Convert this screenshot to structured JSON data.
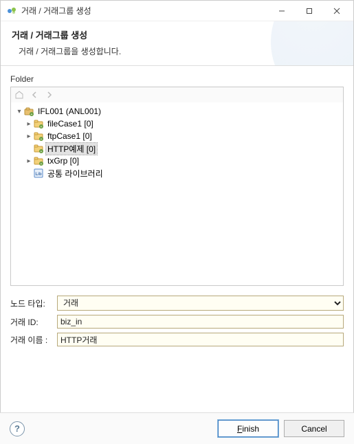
{
  "window": {
    "title": "거래 / 거래그룹 생성"
  },
  "header": {
    "heading": "거래 / 거래그룹 생성",
    "subtitle": "거래 / 거래그룹을 생성합니다."
  },
  "folder": {
    "label": "Folder",
    "root": {
      "label": "IFL001  (ANL001)"
    },
    "children": [
      {
        "label": "fileCase1 [0]",
        "expandable": true
      },
      {
        "label": "ftpCase1 [0]",
        "expandable": true
      },
      {
        "label": "HTTP예제 [0]",
        "expandable": false,
        "selected": true
      },
      {
        "label": "txGrp [0]",
        "expandable": true
      },
      {
        "label": "공통 라이브러리",
        "expandable": false,
        "lib": true
      }
    ]
  },
  "form": {
    "node_type_label": "노드 타입:",
    "node_type_value": "거래",
    "tx_id_label": "거래 ID:",
    "tx_id_value": "biz_in",
    "tx_name_label": "거래 이름 :",
    "tx_name_value": "HTTP거래"
  },
  "buttons": {
    "finish": "Finish",
    "cancel": "Cancel"
  }
}
